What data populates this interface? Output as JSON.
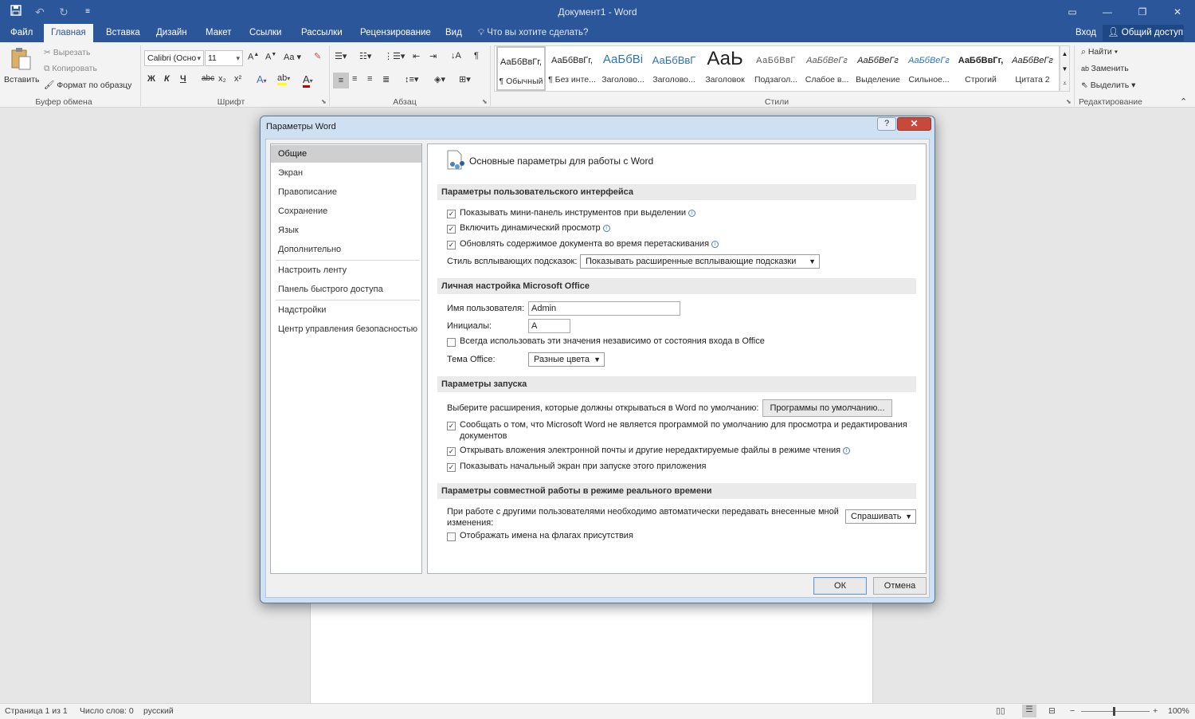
{
  "window": {
    "title": "Документ1 - Word",
    "qat": [
      "save-icon",
      "undo-icon",
      "redo-icon",
      "customize-qat-icon"
    ],
    "buttons": [
      "ribbon-display-icon",
      "minimize-icon",
      "restore-icon",
      "close-icon"
    ]
  },
  "tabs": {
    "items": [
      "Файл",
      "Главная",
      "Вставка",
      "Дизайн",
      "Макет",
      "Ссылки",
      "Рассылки",
      "Рецензирование",
      "Вид"
    ],
    "active": "Главная",
    "tellme": "Что вы хотите сделать?",
    "signin": "Вход",
    "share": "Общий доступ"
  },
  "ribbon": {
    "clipboard": {
      "label": "Буфер обмена",
      "paste": "Вставить",
      "cut": "Вырезать",
      "copy": "Копировать",
      "format_painter": "Формат по образцу"
    },
    "font": {
      "label": "Шрифт",
      "name": "Calibri (Осно",
      "size": "11",
      "bold": "Ж",
      "italic": "К",
      "underline": "Ч",
      "strike": "abc",
      "sub": "x₂",
      "sup": "x²"
    },
    "paragraph": {
      "label": "Абзац"
    },
    "styles": {
      "label": "Стили",
      "items": [
        {
          "preview": "АаБбВвГг,",
          "name": "¶ Обычный"
        },
        {
          "preview": "АаБбВвГг,",
          "name": "¶ Без инте..."
        },
        {
          "preview": "АаБбВі",
          "name": "Заголово..."
        },
        {
          "preview": "АаБбВвГ",
          "name": "Заголово..."
        },
        {
          "preview": "АаЬ",
          "name": "Заголовок"
        },
        {
          "preview": "АаБбВвГ",
          "name": "Подзагол..."
        },
        {
          "preview": "АаБбВеГг",
          "name": "Слабое в..."
        },
        {
          "preview": "АаБбВеГг",
          "name": "Выделение"
        },
        {
          "preview": "АаБбВеГг",
          "name": "Сильное..."
        },
        {
          "preview": "АаБбВвГг,",
          "name": "Строгий"
        },
        {
          "preview": "АаБбВеГг",
          "name": "Цитата 2"
        }
      ]
    },
    "editing": {
      "label": "Редактирование",
      "find": "Найти",
      "replace": "Заменить",
      "select": "Выделить"
    }
  },
  "dialog": {
    "title": "Параметры Word",
    "nav": [
      "Общие",
      "Экран",
      "Правописание",
      "Сохранение",
      "Язык",
      "Дополнительно",
      "Настроить ленту",
      "Панель быстрого доступа",
      "Надстройки",
      "Центр управления безопасностью"
    ],
    "selected_nav": "Общие",
    "header": "Основные параметры для работы с Word",
    "sections": {
      "ui": {
        "title": "Параметры пользовательского интерфейса",
        "mini_toolbar": "Показывать мини-панель инструментов при выделении",
        "live_preview": "Включить динамический просмотр",
        "update_drag": "Обновлять содержимое документа во время перетаскивания",
        "tooltip_label": "Стиль всплывающих подсказок:",
        "tooltip_value": "Показывать расширенные всплывающие подсказки"
      },
      "personal": {
        "title": "Личная настройка Microsoft Office",
        "username_label": "Имя пользователя:",
        "username_value": "Admin",
        "initials_label": "Инициалы:",
        "initials_value": "A",
        "always_use": "Всегда использовать эти значения независимо от состояния входа в Office",
        "theme_label": "Тема Office:",
        "theme_value": "Разные цвета"
      },
      "startup": {
        "title": "Параметры запуска",
        "ext_label": "Выберите расширения, которые должны открываться в Word по умолчанию:",
        "default_programs": "Программы по умолчанию...",
        "notify_default": "Сообщать о том, что Microsoft Word не является программой по умолчанию для просмотра и редактирования",
        "notify_default_2": "документов",
        "open_attachments": "Открывать вложения электронной почты и другие нередактируемые файлы в режиме чтения",
        "show_start": "Показывать начальный экран при запуске этого приложения"
      },
      "coauth": {
        "title": "Параметры совместной работы в режиме реального времени",
        "share_label": "При работе с другими пользователями необходимо автоматически передавать внесенные мной",
        "share_label_2": "изменения:",
        "share_value": "Спрашивать",
        "show_names": "Отображать имена на флагах присутствия"
      }
    },
    "checks": {
      "mini_toolbar": true,
      "live_preview": true,
      "update_drag": true,
      "always_use": false,
      "notify_default": true,
      "open_attachments": true,
      "show_start": true,
      "show_names": false
    },
    "ok": "ОК",
    "cancel": "Отмена"
  },
  "status": {
    "page": "Страница 1 из 1",
    "words": "Число слов: 0",
    "lang": "русский",
    "zoom": "100%"
  }
}
